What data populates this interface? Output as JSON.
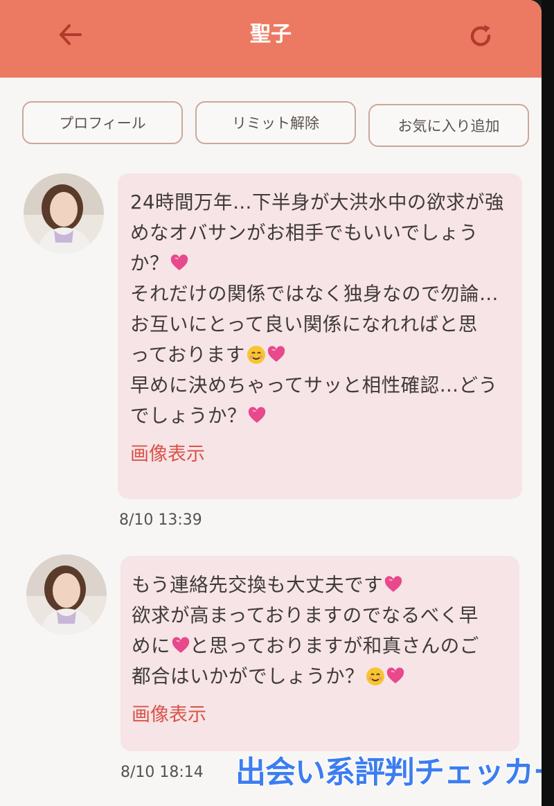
{
  "header": {
    "title": "聖子",
    "back_icon": "arrow-left-icon",
    "refresh_icon": "refresh-icon",
    "color": "#ec7a63"
  },
  "actions": {
    "profile": "プロフィール",
    "limit_release": "リミット解除",
    "add_favorite": "お気に入り追加"
  },
  "messages": [
    {
      "lines": [
        "24時間万年…下半身が大洪水中の欲求が強",
        "めなオバサンがお相手でもいいでしょう",
        "か？",
        "それだけの関係ではなく独身なので勿論…",
        "お互いにとって良い関係になれればと思",
        "っております",
        "早めに決めちゃってサッと相性確認…どう",
        "でしょうか？"
      ],
      "image_link": "画像表示",
      "time": "8/10 13:39"
    },
    {
      "lines": [
        "もう連絡先交換も大丈夫です",
        "欲求が高まっておりますのでなるべく早",
        "めに",
        "と思っておりますが和真さんのご",
        "都合はいかがでしょうか？"
      ],
      "image_link": "画像表示",
      "time": "8/10 18:14"
    }
  ],
  "emoji": {
    "heart": "pink-heart-icon",
    "smile": "smiling-face-icon"
  },
  "watermark": "出会い系評判チェッカー",
  "colors": {
    "bubble": "#f6e4e6",
    "link": "#d9534a",
    "button_border": "#c9a89b"
  }
}
